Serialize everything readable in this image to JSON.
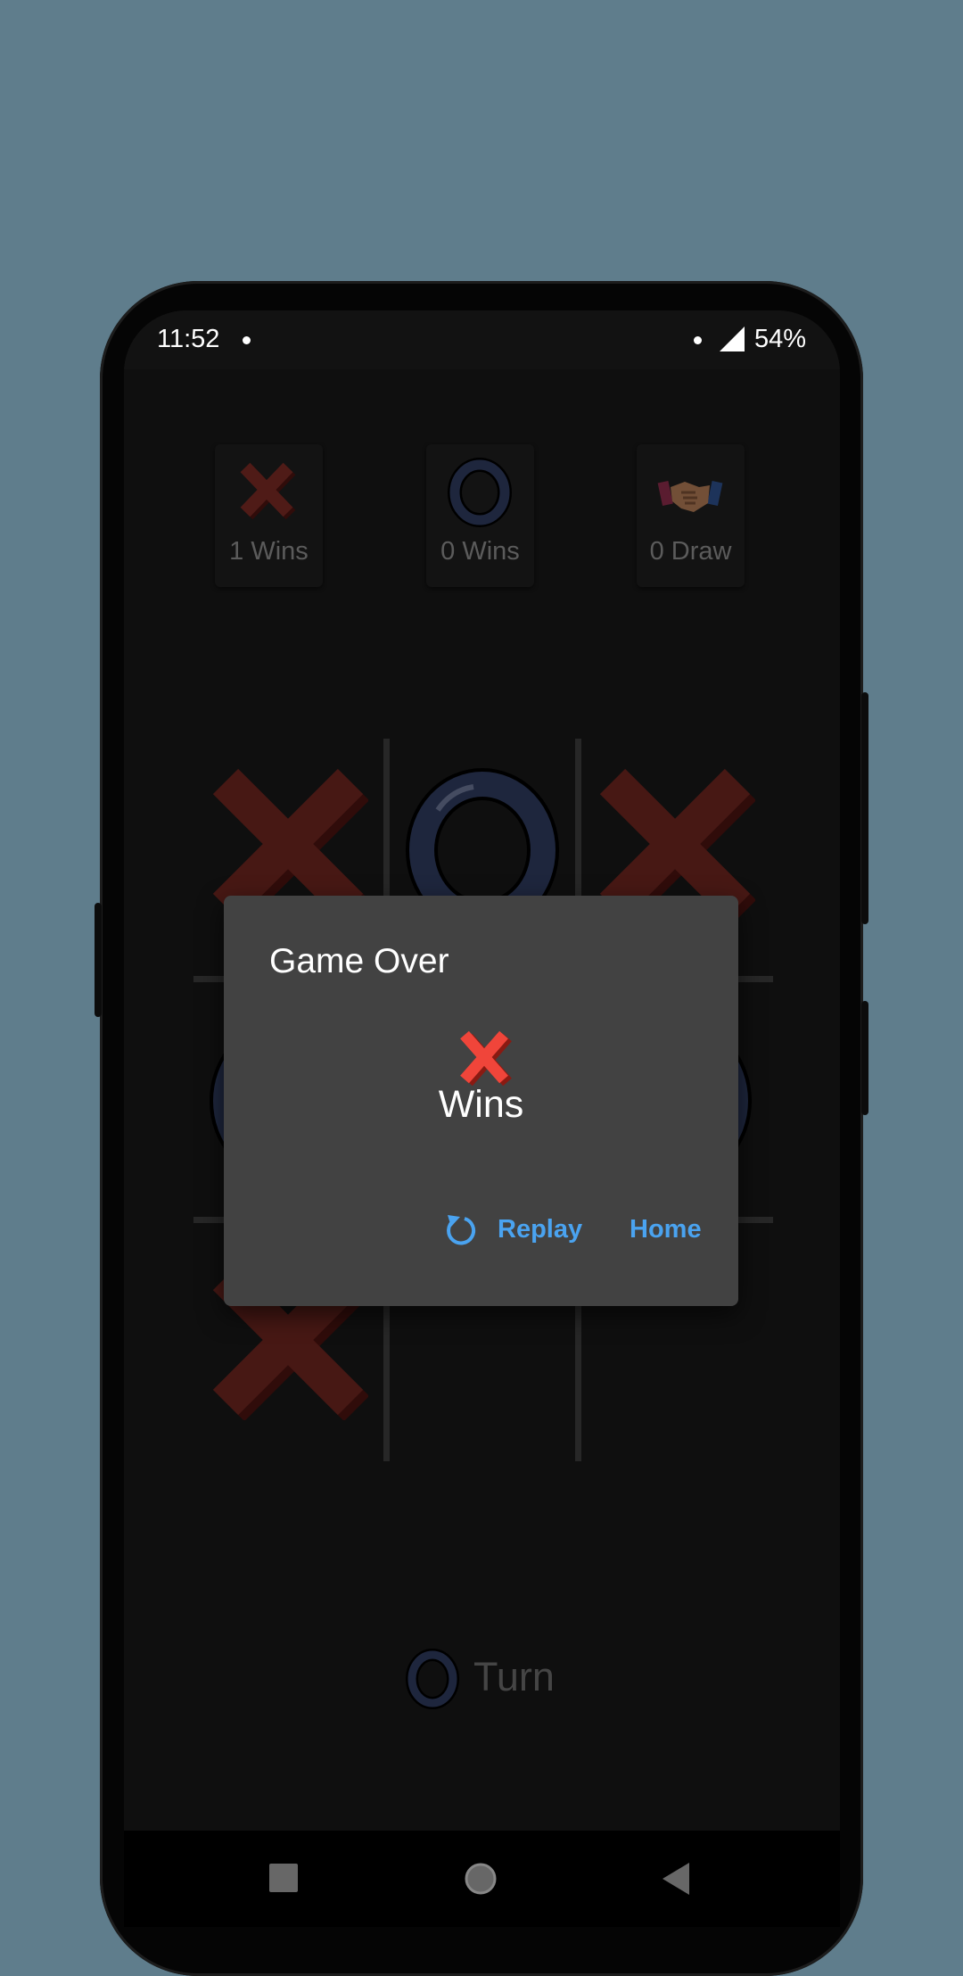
{
  "status_bar": {
    "time": "11:52",
    "battery": "54%",
    "icons": [
      "notification-dot-icon",
      "signal-icon"
    ]
  },
  "scoreboard": [
    {
      "icon": "x-icon",
      "label": "1 Wins"
    },
    {
      "icon": "o-icon",
      "label": "0 Wins"
    },
    {
      "icon": "handshake-icon",
      "label": "0 Draw"
    }
  ],
  "board": {
    "cells": [
      "X",
      "O",
      "X",
      "O",
      "",
      "O",
      "X",
      "",
      ""
    ]
  },
  "turn": {
    "icon": "o-icon",
    "label": "Turn"
  },
  "dialog": {
    "title": "Game Over",
    "winner_icon": "x-icon",
    "result": "Wins",
    "replay_label": "Replay",
    "home_label": "Home"
  },
  "nav": [
    "recents-square-icon",
    "home-circle-icon",
    "back-triangle-icon"
  ],
  "colors": {
    "x_red": "#7a2a24",
    "o_blue": "#2f3b5e",
    "accent_blue": "#4aa3f0",
    "dialog_bg": "#424242",
    "screen_bg": "#171717"
  }
}
